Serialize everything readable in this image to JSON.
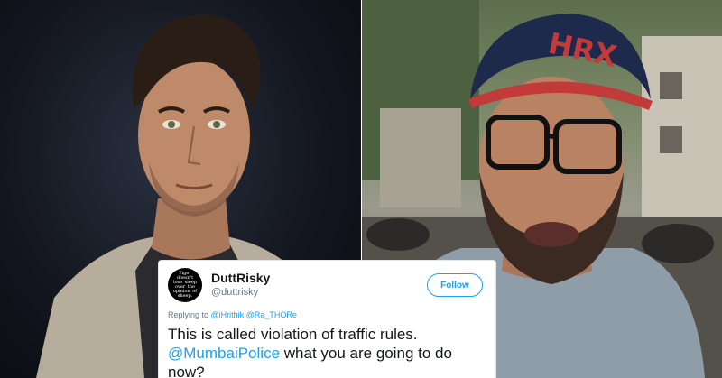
{
  "tweet": {
    "avatar_text": "Tiger doesn't lose sleep over the opinion of sheep.",
    "display_name": "DuttRisky",
    "handle": "@duttrisky",
    "follow_label": "Follow",
    "reply_prefix": "Replying to",
    "reply_mention_1": "@iHrithik",
    "reply_mention_2": "@Ra_THORe",
    "text_part_1": "This is called violation of traffic rules.",
    "text_mention": "@MumbaiPolice",
    "text_part_2": "what you are going to do now?"
  },
  "photos": {
    "right_cap_logo": "HRX"
  },
  "colors": {
    "link": "#1da1f2",
    "text": "#14171a",
    "secondary": "#657786"
  }
}
